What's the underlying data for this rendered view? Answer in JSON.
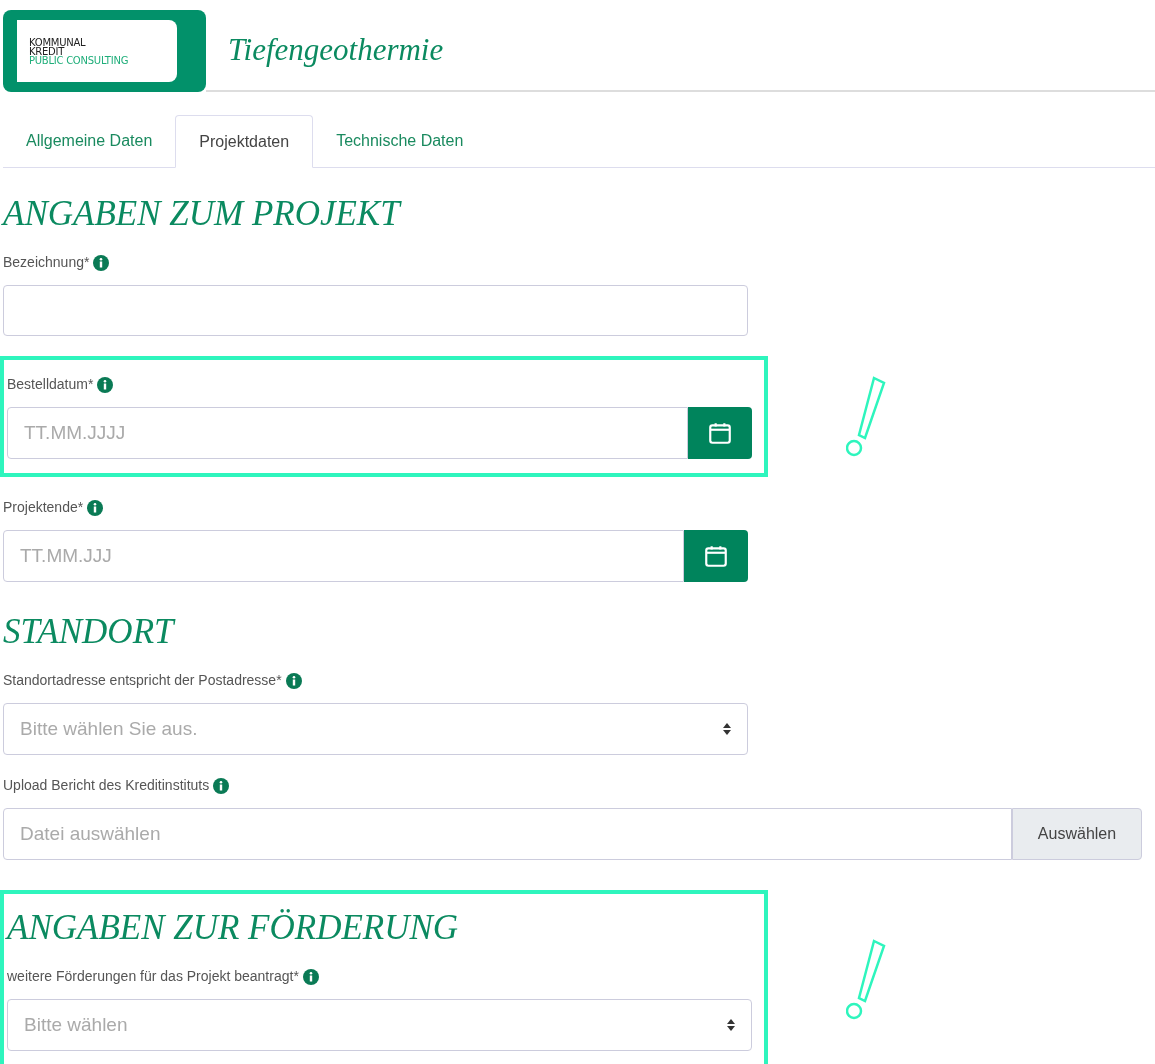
{
  "logo": {
    "lines": [
      "KOMMUNAL",
      "KREDIT",
      "PUBLIC CONSULTING"
    ]
  },
  "title": "Tiefengeothermie",
  "tabs": [
    {
      "label": "Allgemeine Daten",
      "selected": false
    },
    {
      "label": "Projektdaten",
      "selected": true
    },
    {
      "label": "Technische Daten",
      "selected": false
    }
  ],
  "sections": [
    {
      "heading": "ANGABEN ZUM PROJEKT",
      "highlighted": false,
      "fields": [
        {
          "kind": "text",
          "label": "Bezeichnung*",
          "highlighted": false
        },
        {
          "kind": "date",
          "label": "Bestelldatum*",
          "placeholder": "TT.MM.JJJJ",
          "highlighted": true
        },
        {
          "kind": "date",
          "label": "Projektende*",
          "placeholder": "TT.MM.JJJ",
          "highlighted": false
        }
      ]
    },
    {
      "heading": "STANDORT",
      "highlighted": false,
      "fields": [
        {
          "kind": "select",
          "label": "Standortadresse entspricht der Postadresse*",
          "placeholder": "Bitte wählen Sie aus.",
          "highlighted": false
        },
        {
          "kind": "file",
          "label": "Upload Bericht des Kreditinstituts",
          "placeholder": "Datei auswählen",
          "button": "Auswählen",
          "highlighted": false
        }
      ]
    },
    {
      "heading": "ANGABEN ZUR FÖRDERUNG",
      "highlighted": true,
      "fields": [
        {
          "kind": "select",
          "label": "weitere Förderungen für das Projekt beantragt*",
          "placeholder": "Bitte wählen",
          "highlighted": false
        }
      ]
    }
  ]
}
